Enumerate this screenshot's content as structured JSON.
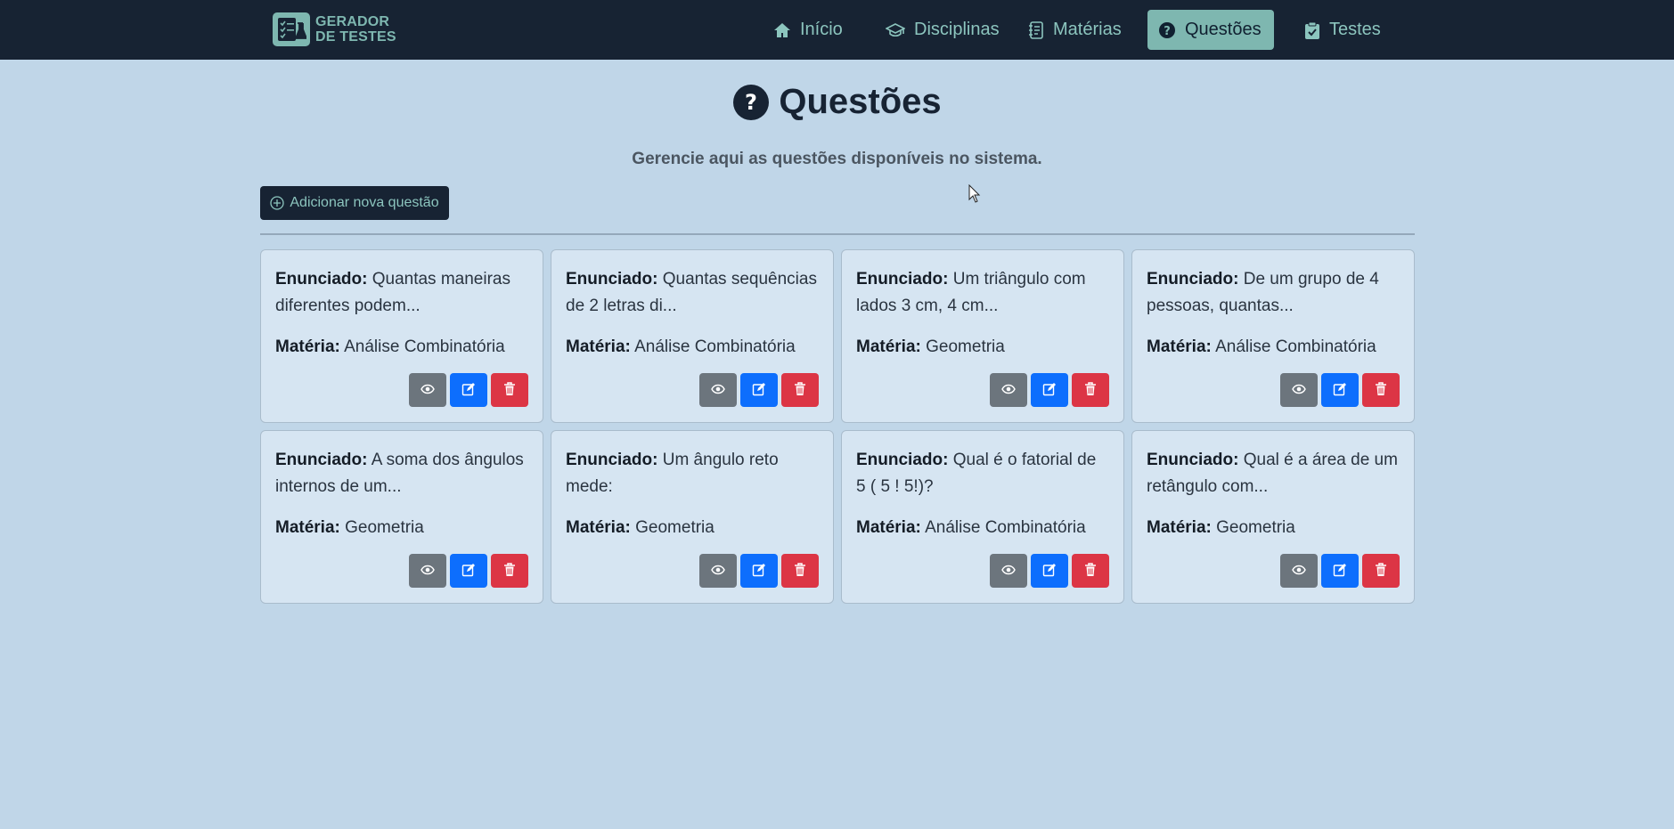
{
  "brand": {
    "line1": "GERADOR",
    "line2": "DE TESTES"
  },
  "nav": [
    {
      "label": "Início",
      "icon": "home-icon",
      "active": false
    },
    {
      "label": "Disciplinas",
      "icon": "graduation-cap-icon",
      "active": false
    },
    {
      "label": "Matérias",
      "icon": "journal-icon",
      "active": false
    },
    {
      "label": "Questões",
      "icon": "question-circle-icon",
      "active": true
    },
    {
      "label": "Testes",
      "icon": "clipboard-check-icon",
      "active": false
    }
  ],
  "page": {
    "title": "Questões",
    "subtitle": "Gerencie aqui as questões disponíveis no sistema.",
    "add_button": "Adicionar nova questão"
  },
  "labels": {
    "enunciado": "Enunciado:",
    "materia": "Matéria:"
  },
  "questions": [
    {
      "enunciado": "Quantas maneiras diferentes podem...",
      "materia": "Análise Combinatória"
    },
    {
      "enunciado": "Quantas sequências de 2 letras di...",
      "materia": "Análise Combinatória"
    },
    {
      "enunciado": "Um triângulo com lados 3 cm, 4 cm...",
      "materia": "Geometria"
    },
    {
      "enunciado": "De um grupo de 4 pessoas, quantas...",
      "materia": "Análise Combinatória"
    },
    {
      "enunciado": "A soma dos ângulos internos de um...",
      "materia": "Geometria"
    },
    {
      "enunciado": "Um ângulo reto mede:",
      "materia": "Geometria"
    },
    {
      "enunciado": "Qual é o fatorial de 5 ( 5 ! 5!)?",
      "materia": "Análise Combinatória"
    },
    {
      "enunciado": "Qual é a área de um retângulo com...",
      "materia": "Geometria"
    }
  ],
  "colors": {
    "background": "#c0d6e8",
    "navbar": "#172333",
    "accent": "#7eb7b0",
    "view": "#6c757d",
    "edit": "#0d6efd",
    "delete": "#dc3545"
  }
}
